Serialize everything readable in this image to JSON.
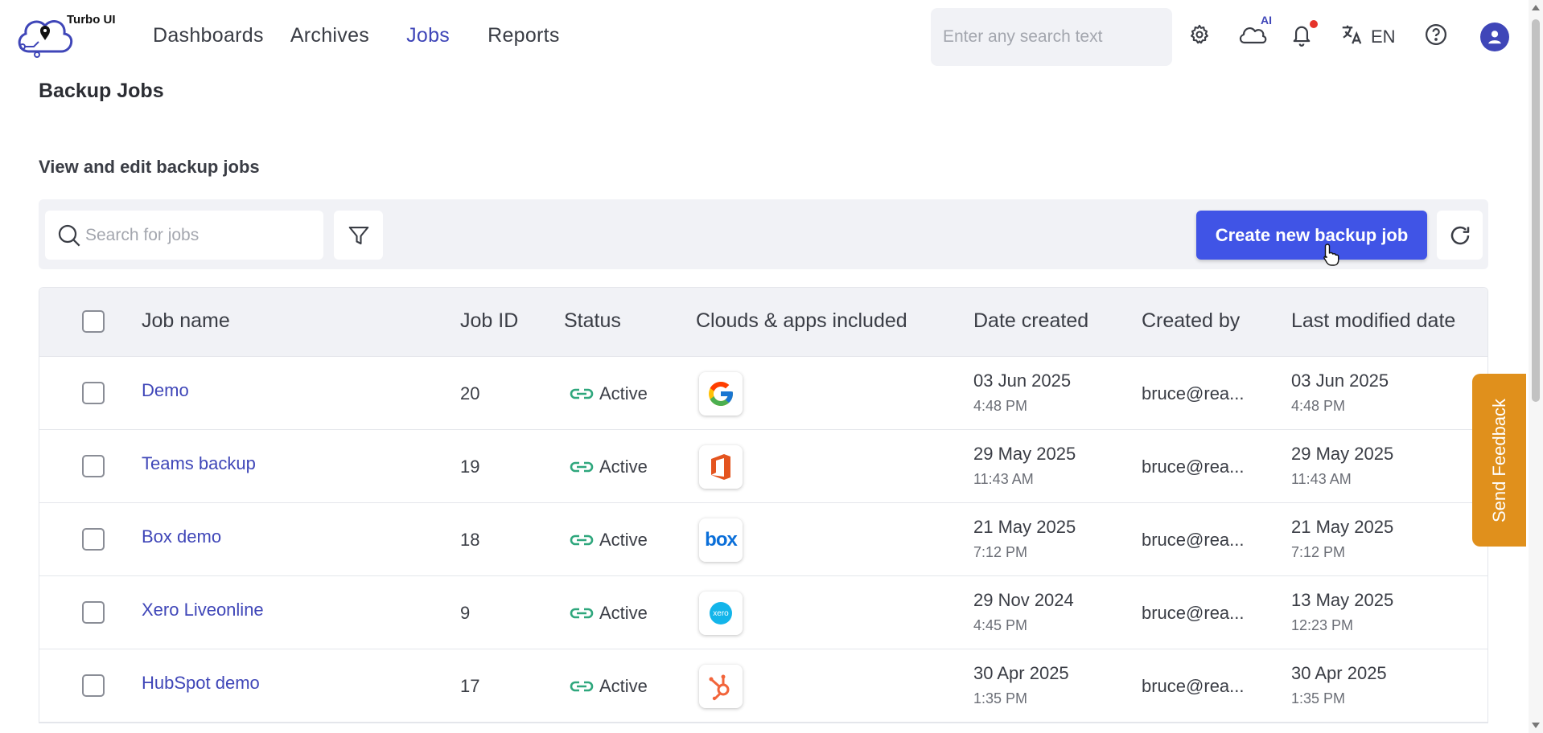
{
  "app": {
    "logo_text": "Turbo UI"
  },
  "nav": [
    {
      "label": "Dashboards"
    },
    {
      "label": "Archives"
    },
    {
      "label": "Jobs",
      "active": true
    },
    {
      "label": "Reports"
    }
  ],
  "header": {
    "search_placeholder": "Enter any search text",
    "ai_label": "AI",
    "language": "EN",
    "icons": [
      "gear-icon",
      "cloud-ai-icon",
      "bell-icon",
      "translate-icon",
      "help-icon",
      "user-avatar-icon"
    ]
  },
  "page": {
    "title": "Backup Jobs",
    "subtitle": "View and edit backup jobs"
  },
  "toolbar": {
    "search_placeholder": "Search for jobs",
    "create_label": "Create new backup job"
  },
  "table": {
    "columns": [
      "Job name",
      "Job ID",
      "Status",
      "Clouds & apps included",
      "Date created",
      "Created by",
      "Last modified date"
    ],
    "rows": [
      {
        "name": "Demo",
        "id": "20",
        "status": "Active",
        "app": "google-icon",
        "created_date": "03 Jun 2025",
        "created_time": "4:48 PM",
        "created_by": "bruce@rea...",
        "modified_date": "03 Jun 2025",
        "modified_time": "4:48 PM"
      },
      {
        "name": "Teams backup",
        "id": "19",
        "status": "Active",
        "app": "office-icon",
        "created_date": "29 May 2025",
        "created_time": "11:43 AM",
        "created_by": "bruce@rea...",
        "modified_date": "29 May 2025",
        "modified_time": "11:43 AM"
      },
      {
        "name": "Box demo",
        "id": "18",
        "status": "Active",
        "app": "box-icon",
        "created_date": "21 May 2025",
        "created_time": "7:12 PM",
        "created_by": "bruce@rea...",
        "modified_date": "21 May 2025",
        "modified_time": "7:12 PM"
      },
      {
        "name": "Xero Liveonline",
        "id": "9",
        "status": "Active",
        "app": "xero-icon",
        "created_date": "29 Nov 2024",
        "created_time": "4:45 PM",
        "created_by": "bruce@rea...",
        "modified_date": "13 May 2025",
        "modified_time": "12:23 PM"
      },
      {
        "name": "HubSpot demo",
        "id": "17",
        "status": "Active",
        "app": "hubspot-icon",
        "created_date": "30 Apr 2025",
        "created_time": "1:35 PM",
        "created_by": "bruce@rea...",
        "modified_date": "30 Apr 2025",
        "modified_time": "1:35 PM"
      }
    ]
  },
  "app_icon_text": {
    "box": "box",
    "xero": "xero"
  },
  "feedback": {
    "label": "Send Feedback"
  },
  "colors": {
    "accent": "#3f46b8",
    "primary_button": "#4054e6",
    "feedback": "#e0901c",
    "status_icon": "#2fa77d"
  }
}
